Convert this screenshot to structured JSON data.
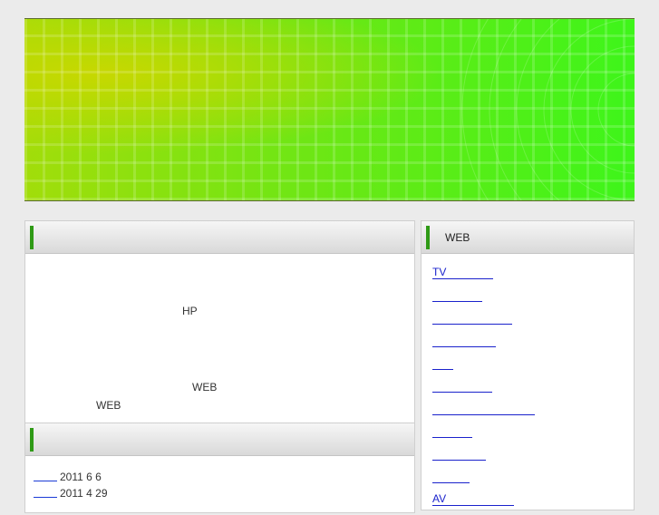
{
  "header": {
    "banner_alt": ""
  },
  "main_panel": {
    "title": "",
    "lines": [
      "HP",
      "WEB",
      "WEB"
    ]
  },
  "news_panel": {
    "title": "",
    "items": [
      {
        "link": "",
        "date": "2011 6 6"
      },
      {
        "link": "",
        "date": "2011 4 29"
      }
    ]
  },
  "side_panel": {
    "title": "WEB",
    "links": [
      {
        "label": "TV",
        "w": 67
      },
      {
        "label": "",
        "w": 55
      },
      {
        "label": "",
        "w": 88
      },
      {
        "label": "",
        "w": 70
      },
      {
        "label": "",
        "w": 23
      },
      {
        "label": "",
        "w": 66
      },
      {
        "label": "",
        "w": 113
      },
      {
        "label": "",
        "w": 44
      },
      {
        "label": "",
        "w": 59
      },
      {
        "label": "",
        "w": 41
      },
      {
        "label": "AV",
        "w": 90
      }
    ]
  },
  "colors": {
    "accent_green": "#2f9a16",
    "link_blue": "#1a22cc",
    "banner_yellow": "#c7d800",
    "banner_green": "#3ef51a"
  }
}
